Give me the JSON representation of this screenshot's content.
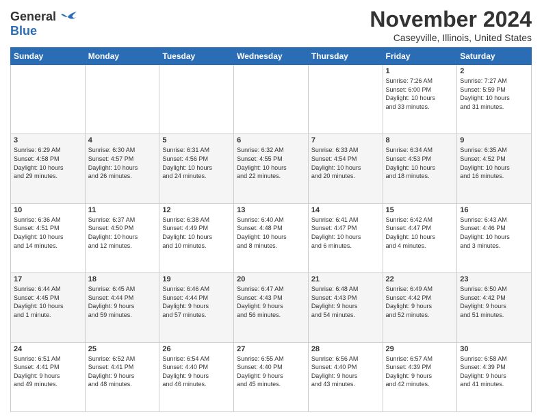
{
  "header": {
    "logo_general": "General",
    "logo_blue": "Blue",
    "month_title": "November 2024",
    "location": "Caseyville, Illinois, United States"
  },
  "days_of_week": [
    "Sunday",
    "Monday",
    "Tuesday",
    "Wednesday",
    "Thursday",
    "Friday",
    "Saturday"
  ],
  "weeks": [
    [
      {
        "day": "",
        "info": ""
      },
      {
        "day": "",
        "info": ""
      },
      {
        "day": "",
        "info": ""
      },
      {
        "day": "",
        "info": ""
      },
      {
        "day": "",
        "info": ""
      },
      {
        "day": "1",
        "info": "Sunrise: 7:26 AM\nSunset: 6:00 PM\nDaylight: 10 hours\nand 33 minutes."
      },
      {
        "day": "2",
        "info": "Sunrise: 7:27 AM\nSunset: 5:59 PM\nDaylight: 10 hours\nand 31 minutes."
      }
    ],
    [
      {
        "day": "3",
        "info": "Sunrise: 6:29 AM\nSunset: 4:58 PM\nDaylight: 10 hours\nand 29 minutes."
      },
      {
        "day": "4",
        "info": "Sunrise: 6:30 AM\nSunset: 4:57 PM\nDaylight: 10 hours\nand 26 minutes."
      },
      {
        "day": "5",
        "info": "Sunrise: 6:31 AM\nSunset: 4:56 PM\nDaylight: 10 hours\nand 24 minutes."
      },
      {
        "day": "6",
        "info": "Sunrise: 6:32 AM\nSunset: 4:55 PM\nDaylight: 10 hours\nand 22 minutes."
      },
      {
        "day": "7",
        "info": "Sunrise: 6:33 AM\nSunset: 4:54 PM\nDaylight: 10 hours\nand 20 minutes."
      },
      {
        "day": "8",
        "info": "Sunrise: 6:34 AM\nSunset: 4:53 PM\nDaylight: 10 hours\nand 18 minutes."
      },
      {
        "day": "9",
        "info": "Sunrise: 6:35 AM\nSunset: 4:52 PM\nDaylight: 10 hours\nand 16 minutes."
      }
    ],
    [
      {
        "day": "10",
        "info": "Sunrise: 6:36 AM\nSunset: 4:51 PM\nDaylight: 10 hours\nand 14 minutes."
      },
      {
        "day": "11",
        "info": "Sunrise: 6:37 AM\nSunset: 4:50 PM\nDaylight: 10 hours\nand 12 minutes."
      },
      {
        "day": "12",
        "info": "Sunrise: 6:38 AM\nSunset: 4:49 PM\nDaylight: 10 hours\nand 10 minutes."
      },
      {
        "day": "13",
        "info": "Sunrise: 6:40 AM\nSunset: 4:48 PM\nDaylight: 10 hours\nand 8 minutes."
      },
      {
        "day": "14",
        "info": "Sunrise: 6:41 AM\nSunset: 4:47 PM\nDaylight: 10 hours\nand 6 minutes."
      },
      {
        "day": "15",
        "info": "Sunrise: 6:42 AM\nSunset: 4:47 PM\nDaylight: 10 hours\nand 4 minutes."
      },
      {
        "day": "16",
        "info": "Sunrise: 6:43 AM\nSunset: 4:46 PM\nDaylight: 10 hours\nand 3 minutes."
      }
    ],
    [
      {
        "day": "17",
        "info": "Sunrise: 6:44 AM\nSunset: 4:45 PM\nDaylight: 10 hours\nand 1 minute."
      },
      {
        "day": "18",
        "info": "Sunrise: 6:45 AM\nSunset: 4:44 PM\nDaylight: 9 hours\nand 59 minutes."
      },
      {
        "day": "19",
        "info": "Sunrise: 6:46 AM\nSunset: 4:44 PM\nDaylight: 9 hours\nand 57 minutes."
      },
      {
        "day": "20",
        "info": "Sunrise: 6:47 AM\nSunset: 4:43 PM\nDaylight: 9 hours\nand 56 minutes."
      },
      {
        "day": "21",
        "info": "Sunrise: 6:48 AM\nSunset: 4:43 PM\nDaylight: 9 hours\nand 54 minutes."
      },
      {
        "day": "22",
        "info": "Sunrise: 6:49 AM\nSunset: 4:42 PM\nDaylight: 9 hours\nand 52 minutes."
      },
      {
        "day": "23",
        "info": "Sunrise: 6:50 AM\nSunset: 4:42 PM\nDaylight: 9 hours\nand 51 minutes."
      }
    ],
    [
      {
        "day": "24",
        "info": "Sunrise: 6:51 AM\nSunset: 4:41 PM\nDaylight: 9 hours\nand 49 minutes."
      },
      {
        "day": "25",
        "info": "Sunrise: 6:52 AM\nSunset: 4:41 PM\nDaylight: 9 hours\nand 48 minutes."
      },
      {
        "day": "26",
        "info": "Sunrise: 6:54 AM\nSunset: 4:40 PM\nDaylight: 9 hours\nand 46 minutes."
      },
      {
        "day": "27",
        "info": "Sunrise: 6:55 AM\nSunset: 4:40 PM\nDaylight: 9 hours\nand 45 minutes."
      },
      {
        "day": "28",
        "info": "Sunrise: 6:56 AM\nSunset: 4:40 PM\nDaylight: 9 hours\nand 43 minutes."
      },
      {
        "day": "29",
        "info": "Sunrise: 6:57 AM\nSunset: 4:39 PM\nDaylight: 9 hours\nand 42 minutes."
      },
      {
        "day": "30",
        "info": "Sunrise: 6:58 AM\nSunset: 4:39 PM\nDaylight: 9 hours\nand 41 minutes."
      }
    ]
  ]
}
